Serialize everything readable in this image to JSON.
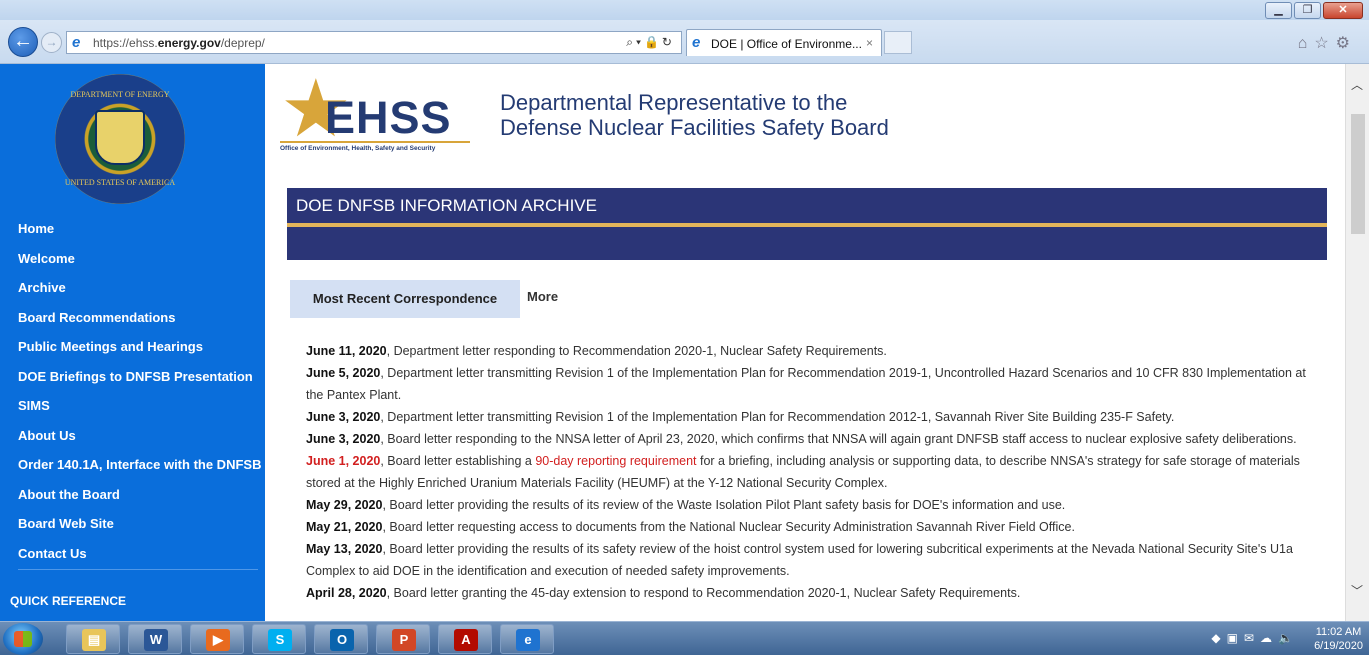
{
  "browser": {
    "url_host": "https://ehss.",
    "url_domain": "energy.gov",
    "url_path": "/deprep/",
    "tab_title": "DOE | Office of Environme...",
    "tab_close": "×"
  },
  "sidebar": {
    "seal_top": "DEPARTMENT OF ENERGY",
    "seal_bottom": "UNITED STATES OF AMERICA",
    "items": [
      {
        "label": "Home"
      },
      {
        "label": "Welcome"
      },
      {
        "label": "Archive"
      },
      {
        "label": "Board Recommendations"
      },
      {
        "label": "Public Meetings and Hearings"
      },
      {
        "label": "DOE Briefings to DNFSB Presentation"
      },
      {
        "label": "SIMS"
      },
      {
        "label": "About Us"
      },
      {
        "label": "Order 140.1A, Interface with the DNFSB"
      },
      {
        "label": "About the Board"
      },
      {
        "label": "Board Web Site"
      },
      {
        "label": "Contact Us"
      }
    ],
    "quick_reference": "QUICK REFERENCE"
  },
  "header": {
    "logo_text": "EHSS",
    "logo_subtitle": "Office of Environment, Health, Safety and Security",
    "title_line1": "Departmental Representative to the",
    "title_line2": "Defense Nuclear Facilities Safety Board"
  },
  "banner": {
    "title": "DOE DNFSB INFORMATION ARCHIVE"
  },
  "tabs": {
    "active": "Most Recent Correspondence",
    "more": "More"
  },
  "entries": [
    {
      "date": "June 11, 2020",
      "text": ", Department letter responding to Recommendation 2020-1, Nuclear Safety Requirements."
    },
    {
      "date": "June 5, 2020",
      "text": ", Department letter transmitting Revision 1 of the Implementation Plan for Recommendation 2019-1, Uncontrolled Hazard Scenarios and 10 CFR 830 Implementation at the Pantex Plant."
    },
    {
      "date": "June 3, 2020",
      "text": ", Department letter transmitting Revision 1 of the Implementation Plan for Recommendation 2012-1, Savannah River Site Building 235-F Safety."
    },
    {
      "date": "June 3, 2020",
      "text": ", Board letter responding to the NNSA letter of April 23, 2020, which confirms that NNSA will again grant DNFSB staff access to nuclear explosive safety deliberations."
    },
    {
      "date": "June 1, 2020",
      "pre": ", Board letter establishing a ",
      "highlight": "90-day reporting requirement",
      "text": " for a briefing, including analysis or supporting data, to describe NNSA's strategy for safe storage of materials stored at the Highly Enriched Uranium Materials Facility (HEUMF) at the Y-12 National Security Complex."
    },
    {
      "date": "May 29, 2020",
      "text": ", Board letter providing the results of its review of the Waste Isolation Pilot Plant safety basis for DOE's information and use."
    },
    {
      "date": "May 21, 2020",
      "text": ", Board letter requesting access to documents from the National Nuclear Security Administration Savannah River Field Office."
    },
    {
      "date": "May 13, 2020",
      "text": ", Board letter providing the results of its safety review of the hoist control system used for lowering subcritical experiments at the Nevada National Security Site's U1a Complex to aid DOE in the identification and execution of needed safety improvements."
    },
    {
      "date": "April 28, 2020",
      "text": ", Board letter granting the 45-day extension to respond to Recommendation 2020-1, Nuclear Safety Requirements."
    }
  ],
  "taskbar": {
    "apps": [
      {
        "name": "explorer",
        "glyph": "▤",
        "color": "#e8c55a"
      },
      {
        "name": "word",
        "glyph": "W",
        "color": "#2b5797"
      },
      {
        "name": "media",
        "glyph": "▶",
        "color": "#e86a1e"
      },
      {
        "name": "skype",
        "glyph": "S",
        "color": "#00aff0"
      },
      {
        "name": "outlook",
        "glyph": "O",
        "color": "#0a64ad"
      },
      {
        "name": "powerpoint",
        "glyph": "P",
        "color": "#d24726"
      },
      {
        "name": "acrobat",
        "glyph": "A",
        "color": "#b30b00"
      },
      {
        "name": "internet-explorer",
        "glyph": "e",
        "color": "#1f73d0"
      }
    ],
    "time": "11:02 AM",
    "date": "6/19/2020"
  }
}
